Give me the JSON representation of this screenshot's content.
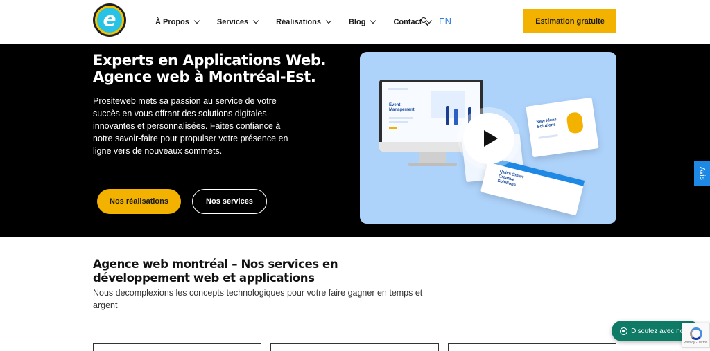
{
  "header": {
    "logo_letter": "e",
    "nav": [
      {
        "label": "À Propos",
        "has_dropdown": true
      },
      {
        "label": "Services",
        "has_dropdown": true
      },
      {
        "label": "Réalisations",
        "has_dropdown": true
      },
      {
        "label": "Blog",
        "has_dropdown": true
      },
      {
        "label": "Contact",
        "has_dropdown": true
      }
    ],
    "search_icon": "search-icon",
    "language": "EN",
    "cta_label": "Estimation gratuite"
  },
  "hero": {
    "title_line1": "Experts en Applications Web.",
    "title_line2": "Agence web à Montréal-Est.",
    "description": "Prositeweb mets sa passion au service de votre succès en vous offrant des solutions digitales innovantes et personnalisées. Faites confiance à notre savoir-faire pour propulser votre présence en ligne vers de nouveaux sommets.",
    "primary_button": "Nos réalisations",
    "secondary_button": "Nos services",
    "video": {
      "screen_heading": "Event Management",
      "sheet1_heading": "New Ideas Solutions",
      "sheet2_heading": "Quick Smart Creative Solutions",
      "play_icon": "play-icon"
    }
  },
  "side_tab": "Avis",
  "services": {
    "title": "Agence web montréal – Nos services en développement web et applications",
    "subtitle": "Nous decomplexions les concepts technologiques pour votre faire gagner en temps et argent"
  },
  "chat": {
    "label": "Discutez avec nous",
    "icon": "whatsapp-icon"
  },
  "recaptcha": {
    "text": "Privacy - Terms"
  },
  "colors": {
    "accent_yellow": "#f3b200",
    "hero_bg": "#000000",
    "link_blue": "#2f7fd8",
    "chat_green": "#0f7a66",
    "tab_blue": "#1e88e5"
  }
}
